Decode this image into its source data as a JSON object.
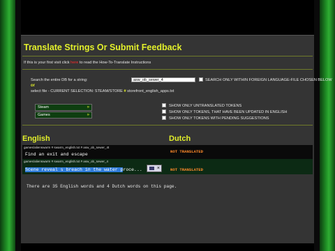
{
  "panel": {
    "title": "Translate Strings Or Submit Feedback",
    "intro_before": "If this is your first visit click ",
    "intro_link": "here",
    "intro_after": " to read the How-To-Translate Instructions"
  },
  "search": {
    "label": "Search the entire DB for a string:",
    "value": "asw_ob_sewer_4",
    "checkbox_label": "SEARCH ONLY WITHIN FOREIGN LANGUAGE-FILE CHOSEN BELOW",
    "or_text": "or",
    "select_file_prefix": "select file - CURRENT SELECTION: STEAM/STORE ",
    "select_file_name": "storefront_english_apps.txt",
    "hash_symbol": "#"
  },
  "platforms": [
    {
      "label": "Steam",
      "arrow": "»"
    },
    {
      "label": "Games",
      "arrow": "»"
    }
  ],
  "filters": [
    "SHOW ONLY UNTRANSLATED TOKENS",
    "SHOW ONLY TOKENS, THAT HAVE BEEN UPDATED IN ENGLISH",
    "SHOW ONLY TOKENS WITH PENDING SUGGESTIONS"
  ],
  "columns": {
    "left": "English",
    "right": "Dutch"
  },
  "rows": [
    {
      "path": "games/alienswarm # swarm_english.txt # asw_ob_sewer_4t",
      "english": "Find an exit and escape",
      "dutch": "NOT TRANSLATED"
    },
    {
      "path": "games/alienswarm # swarm_english.txt # asw_ob_sewer_4",
      "english_highlight": "Scene reveal s breach in the water p",
      "english_rest": "roce...",
      "dutch": "NOT TRANSLATED"
    }
  ],
  "footer": "There are 35 English words and 4 Dutch words on this page.",
  "colors": {
    "accent": "#e2ef2b",
    "panel": "#343434",
    "not_translated": "#ff8a2a",
    "side_green": "#2fae33"
  },
  "icons": [
    "checkbox-icon",
    "edit-icon",
    "close-icon",
    "arrow-right-icon"
  ]
}
